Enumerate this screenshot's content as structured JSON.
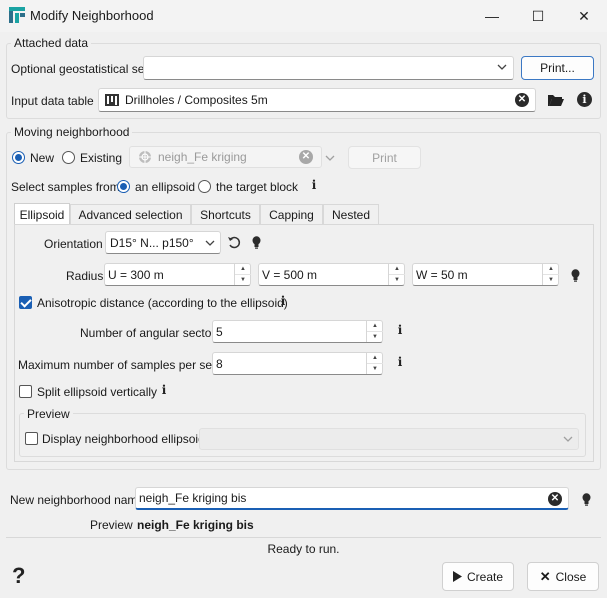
{
  "window": {
    "title": "Modify Neighborhood",
    "minimize": "—",
    "maximize": "☐",
    "close": "✕"
  },
  "attached": {
    "group_label": "Attached data",
    "geostat_label": "Optional geostatistical set",
    "geostat_value": "",
    "print_button": "Print...",
    "input_table_label": "Input data table",
    "input_table_value": "Drillholes / Composites 5m"
  },
  "moving": {
    "group_label": "Moving neighborhood",
    "new_label": "New",
    "existing_label": "Existing",
    "existing_value": "neigh_Fe kriging",
    "print_button": "Print",
    "select_samples_label": "Select samples from:",
    "ellipsoid_option": "an ellipsoid",
    "target_block_option": "the target block",
    "tabs": [
      {
        "label": "Ellipsoid"
      },
      {
        "label": "Advanced selection"
      },
      {
        "label": "Shortcuts"
      },
      {
        "label": "Capping"
      },
      {
        "label": "Nested"
      }
    ],
    "orientation_label": "Orientation",
    "orientation_value": "D15° N... p150°",
    "radius_label": "Radius",
    "radius_u": "U = 300 m",
    "radius_v": "V = 500 m",
    "radius_w": "W = 50 m",
    "anisotropic_label": "Anisotropic distance (according to the ellipsoid)",
    "angular_sectors_label": "Number of angular sectors",
    "angular_sectors_value": "5",
    "max_samples_label": "Maximum number of samples per sector",
    "max_samples_value": "8",
    "split_label": "Split ellipsoid vertically",
    "preview_group_label": "Preview",
    "display_ellipsoid_label": "Display neighborhood ellipsoid",
    "display_select_value": ""
  },
  "naming": {
    "name_label": "New neighborhood name",
    "name_value": "neigh_Fe kriging bis",
    "preview_label": "Preview",
    "preview_value": "neigh_Fe kriging bis"
  },
  "status": "Ready to run.",
  "footer": {
    "help": "?",
    "create_button": "Create",
    "close_button": "Close"
  },
  "colors": {
    "accent": "#1a5fb4",
    "logo_teal": "#1aa3a3"
  }
}
